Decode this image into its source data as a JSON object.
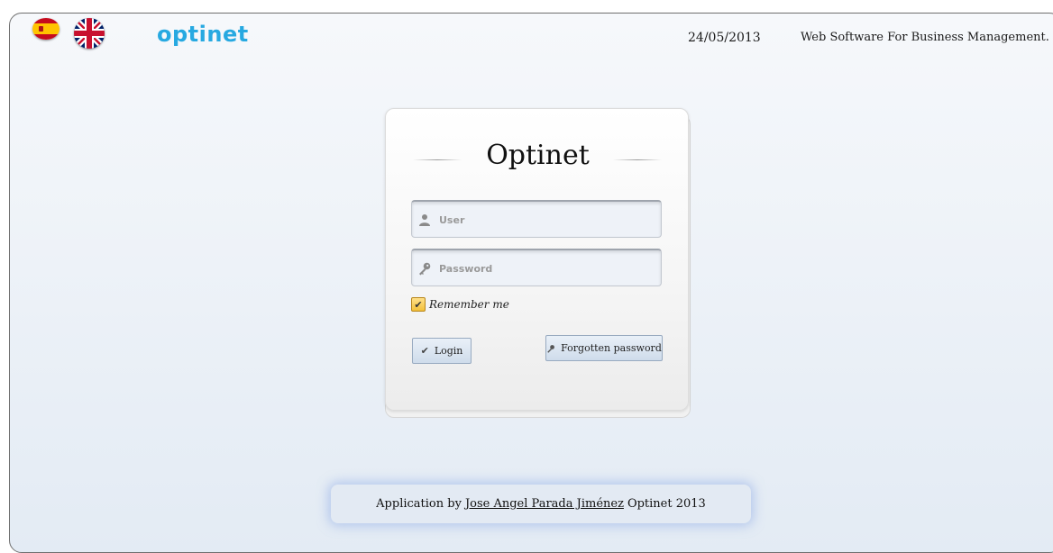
{
  "header": {
    "logo_text": "optinet",
    "date": "24/05/2013",
    "tagline": "Web Software For Business Management.",
    "languages": [
      {
        "name": "spanish-flag-icon"
      },
      {
        "name": "uk-flag-icon"
      }
    ]
  },
  "login": {
    "title": "Optinet",
    "user_placeholder": "User",
    "password_placeholder": "Password",
    "remember_label": "Remember me",
    "remember_checked": true,
    "login_label": "Login",
    "forgot_label": "Forgotten password"
  },
  "footer": {
    "prefix": "Application by",
    "author": "Jose Angel Parada Jiménez",
    "suffix": "Optinet 2013"
  },
  "colors": {
    "logo": "#27a9e1",
    "background_top": "#f6f8fb",
    "background_bottom": "#e3ebf4",
    "button": "#cfdceb",
    "checkbox": "#f3c03a"
  }
}
